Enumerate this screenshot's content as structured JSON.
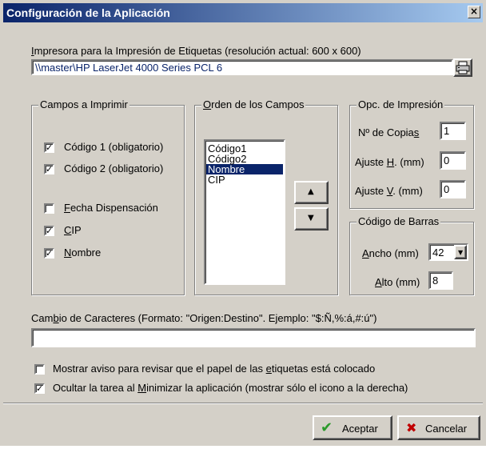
{
  "window": {
    "title": "Configuración de la Aplicación",
    "close_glyph": "×"
  },
  "printer": {
    "label_pre": "",
    "label_u": "I",
    "label_post": "mpresora para la Impresión de Etiquetas  (resolución actual: 600 x 600)",
    "value": "\\\\master\\HP LaserJet 4000 Series PCL 6"
  },
  "fields_group": {
    "title": "Campos a Imprimir",
    "items": [
      {
        "checked": true,
        "pre": "Código 1  (obligatorio)",
        "u": "",
        "post": ""
      },
      {
        "checked": true,
        "pre": "Código 2  (obligatorio)",
        "u": "",
        "post": ""
      },
      {
        "checked": false,
        "pre": "",
        "u": "F",
        "post": "echa Dispensación"
      },
      {
        "checked": true,
        "pre": "",
        "u": "C",
        "post": "IP"
      },
      {
        "checked": true,
        "pre": "",
        "u": "N",
        "post": "ombre"
      }
    ],
    "check_mark": "✓"
  },
  "order_group": {
    "title_u": "O",
    "title_post": "rden de los Campos",
    "items": [
      "Código1",
      "Código2",
      "Nombre",
      "CIP"
    ],
    "selected_index": 2,
    "up_glyph": "▲",
    "down_glyph": "▼"
  },
  "print_opts": {
    "title": "Opc. de Impresión",
    "copies": {
      "pre": "Nº de Copia",
      "u": "s",
      "post": "",
      "value": "1"
    },
    "adj_h": {
      "pre": "Ajuste ",
      "u": "H",
      "post": ". (mm)",
      "value": "0"
    },
    "adj_v": {
      "pre": "Ajuste ",
      "u": "V",
      "post": ". (mm)",
      "value": "0"
    }
  },
  "barcode": {
    "title": "Código de Barras",
    "width": {
      "pre": "",
      "u": "A",
      "post": "ncho (mm)",
      "value": "42"
    },
    "height": {
      "pre": "",
      "u": "A",
      "post": "lto (mm)",
      "value": "8"
    },
    "dropdown_glyph": "▼"
  },
  "char_change": {
    "label_pre": "Cam",
    "label_u": "b",
    "label_post": "io de Caracteres  (Formato: \"Origen:Destino\". Ejemplo: \"$:Ñ,%:á,#:ú\")",
    "value": ""
  },
  "options": [
    {
      "checked": false,
      "pre": "Mostrar aviso para revisar que el papel de las ",
      "u": "e",
      "post": "tiquetas está colocado"
    },
    {
      "checked": true,
      "pre": "Ocultar la tarea al ",
      "u": "M",
      "post": "inimizar la aplicación  (mostrar sólo el icono a la derecha)"
    }
  ],
  "buttons": {
    "ok": "Aceptar",
    "cancel": "Cancelar",
    "ok_glyph": "✔",
    "cancel_glyph": "✖"
  },
  "colors": {
    "titlebar": "#0a246a",
    "face": "#d4d0c8",
    "selection": "#0a246a",
    "printer_text": "#0a246a",
    "ok_icon": "#2a9a2a",
    "cancel_icon": "#c00000"
  }
}
